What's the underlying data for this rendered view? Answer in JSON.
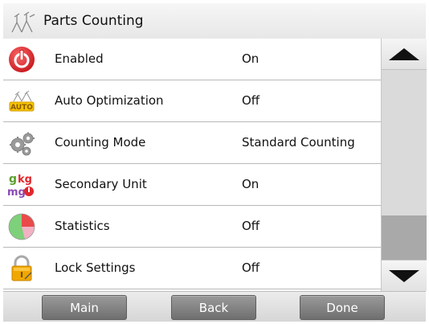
{
  "header": {
    "title": "Parts Counting",
    "icon": "parts-counting-icon"
  },
  "settings": [
    {
      "label": "Enabled",
      "value": "On",
      "icon": "power-icon"
    },
    {
      "label": "Auto Optimization",
      "value": "Off",
      "icon": "auto-optimization-icon"
    },
    {
      "label": "Counting Mode",
      "value": "Standard Counting",
      "icon": "gears-icon"
    },
    {
      "label": "Secondary Unit",
      "value": "On",
      "icon": "units-icon"
    },
    {
      "label": "Statistics",
      "value": "Off",
      "icon": "pie-chart-icon"
    },
    {
      "label": "Lock Settings",
      "value": "Off",
      "icon": "padlock-icon"
    }
  ],
  "footer": {
    "main_label": "Main",
    "back_label": "Back",
    "done_label": "Done"
  },
  "colors": {
    "scroll_thumb": "#a9a9a9",
    "button": "#808080",
    "power_red": "#e0282d"
  }
}
